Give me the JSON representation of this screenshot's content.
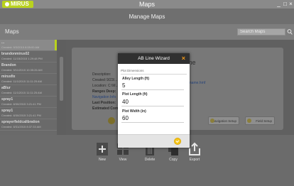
{
  "app": {
    "logo_text": "MIRUS",
    "window_title": "Maps",
    "page_title": "Manage Maps",
    "min_label": "_",
    "max_label": "□",
    "close_label": "×"
  },
  "maps_bar": {
    "label": "Maps",
    "search_placeholder": "Search Maps"
  },
  "sidebar": {
    "items": [
      {
        "name": "...",
        "date": "Created: 9/3/2015 8:55:00 AM",
        "selected": true
      },
      {
        "name": "brandonmirus02",
        "date": "Created: 11/15/2015 1:29:48 PM",
        "selected": false
      },
      {
        "name": "Brandon",
        "date": "Created: 9/11/2015 10:35:26 AM",
        "selected": false
      },
      {
        "name": "mirusfix",
        "date": "Created: 11/1/2015 11:11:25 AM",
        "selected": false
      },
      {
        "name": "aBlur",
        "date": "Created: 11/1/2015 11:11:25 AM",
        "selected": false
      },
      {
        "name": "spray1",
        "date": "Created: 8/30/2015 3:21:41 PM",
        "selected": false
      },
      {
        "name": "spray1",
        "date": "Created: 8/30/2015 3:21:41 PM",
        "selected": false
      },
      {
        "name": "sprayerfieldcalibration",
        "date": "Created: 8/31/2015 8:37:33 AM",
        "selected": false
      }
    ]
  },
  "details": {
    "description_label": "Description:",
    "created_label": "Created:",
    "created_value": "9/23/...",
    "location_label": "Location:",
    "location_value": "C:\\M...",
    "ranges_label": "Ranges Deep:",
    "navigation_label": "Navigation Info",
    "last_position_label": "Last Position:",
    "estimated_label": "Estimated Com",
    "name_fragment": "me",
    "file_fragment": "absolutename.hmf"
  },
  "actions": [
    {
      "label": "Navigation Setup"
    },
    {
      "label": "Field Setup"
    }
  ],
  "toolbar": {
    "items": [
      {
        "label": "New",
        "icon": "plus-square-icon"
      },
      {
        "label": "View",
        "icon": "map-icon"
      },
      {
        "label": "Delete",
        "icon": "trash-icon"
      },
      {
        "label": "Copy",
        "icon": "copy-icon"
      },
      {
        "label": "Export",
        "icon": "export-icon"
      }
    ]
  },
  "dialog": {
    "title": "AB Line Wizard",
    "close_glyph": "×",
    "section": "Plot Dimensions",
    "fields": [
      {
        "label": "Alley Length (ft)",
        "value": "5"
      },
      {
        "label": "Plot Length (ft)",
        "value": "40"
      },
      {
        "label": "Plot Width (in)",
        "value": "60"
      }
    ]
  },
  "colors": {
    "accent": "#b9d21d",
    "dialog_close": "#f29a1a",
    "ok_button": "#f5c51c"
  }
}
